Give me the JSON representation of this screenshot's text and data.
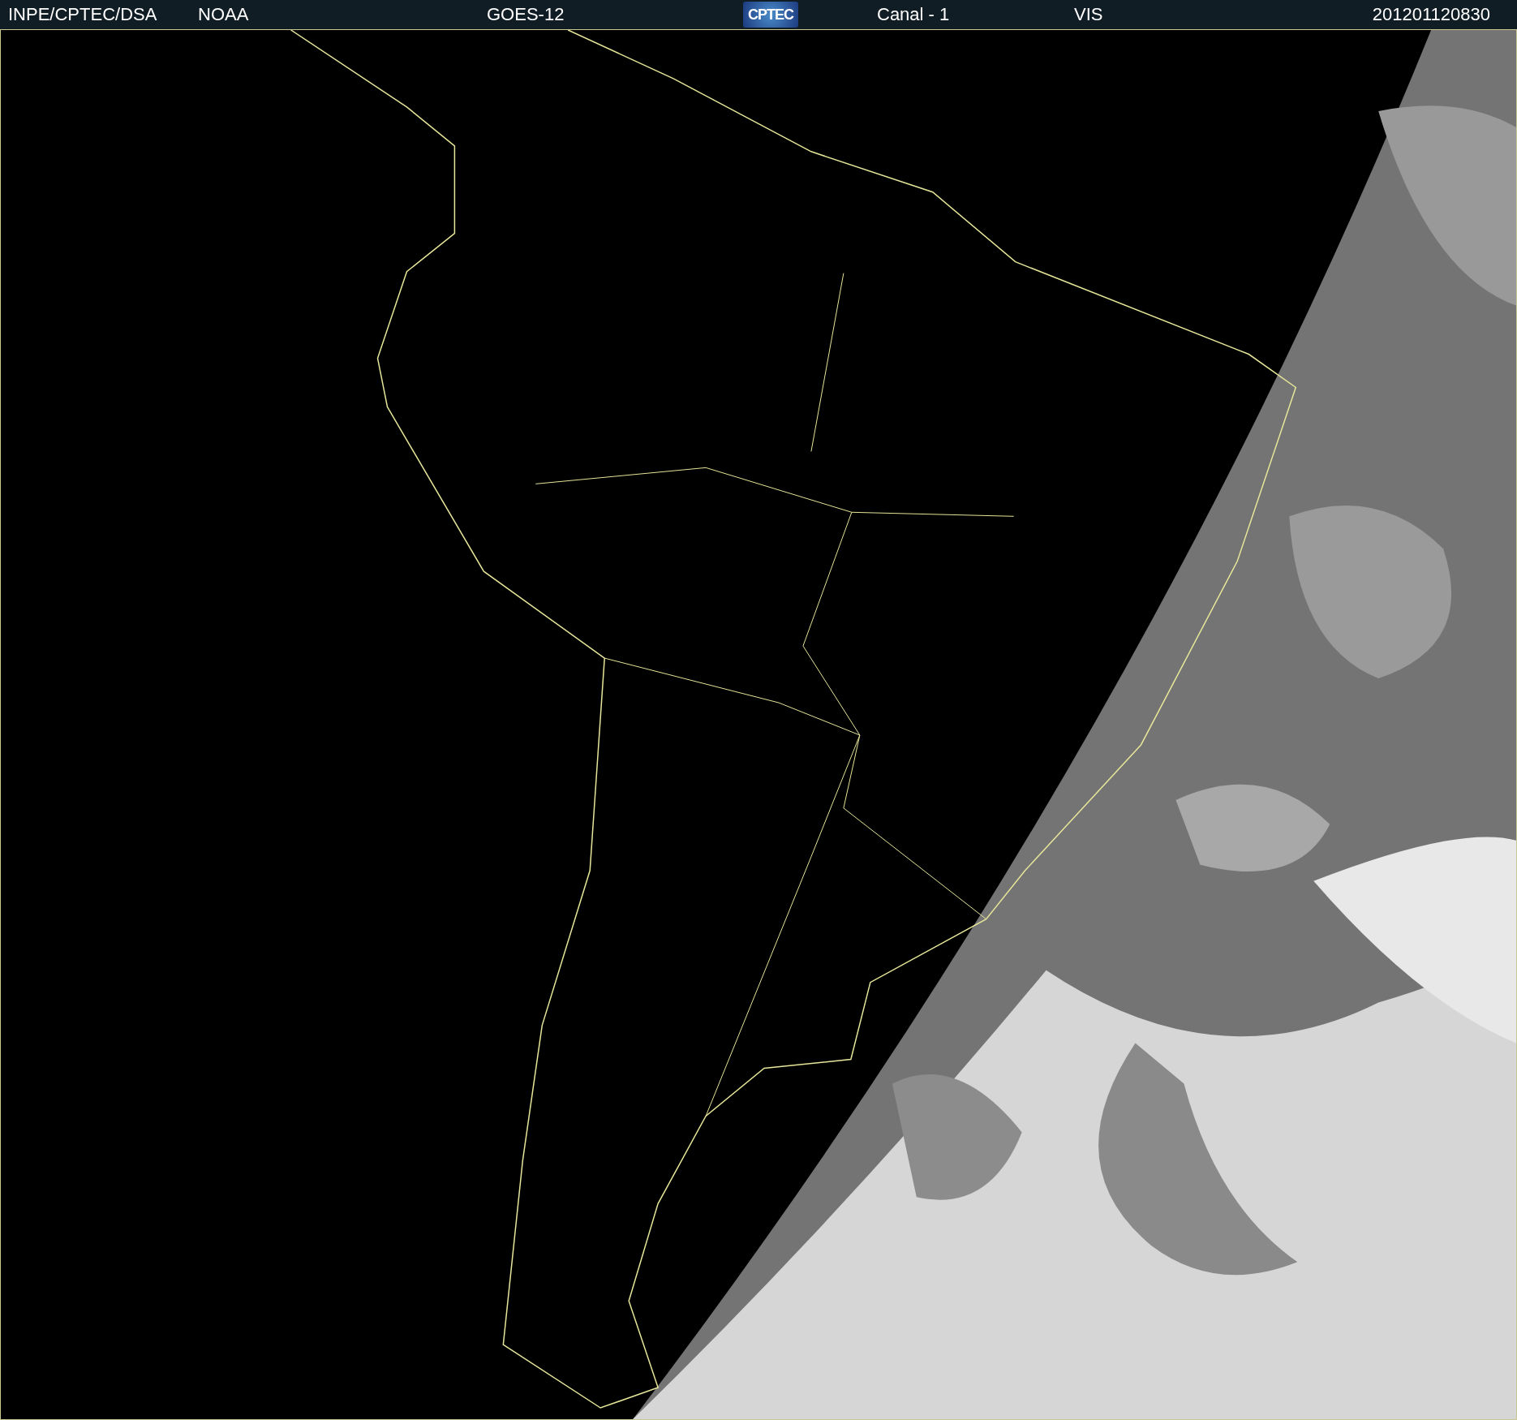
{
  "header": {
    "items": [
      {
        "kind": "text",
        "text": "INPE/CPTEC/DSA"
      },
      {
        "kind": "text",
        "text": "NOAA"
      },
      {
        "kind": "text",
        "text": "GOES-12"
      },
      {
        "kind": "logo",
        "text": "CPTEC"
      },
      {
        "kind": "text",
        "text": "Canal - 1"
      },
      {
        "kind": "text",
        "text": "VIS"
      },
      {
        "kind": "text",
        "text": "201201120830"
      }
    ]
  }
}
